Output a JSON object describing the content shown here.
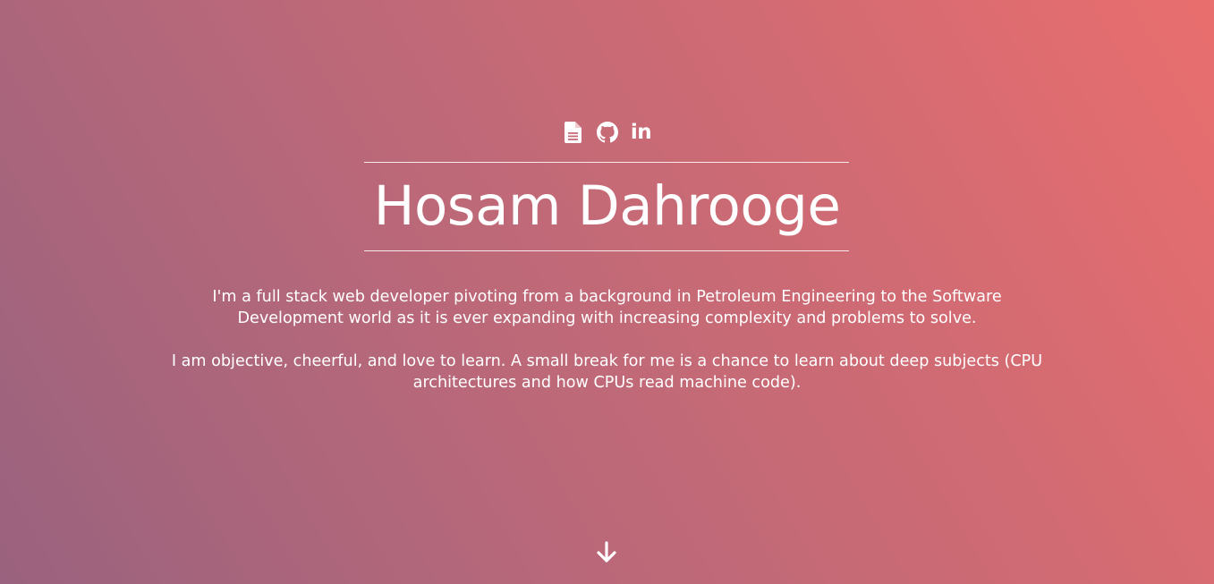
{
  "social": {
    "items": [
      {
        "icon": "file-document-icon",
        "label": "Resume"
      },
      {
        "icon": "github-icon",
        "label": "GitHub"
      },
      {
        "icon": "linkedin-icon",
        "label": "in"
      }
    ]
  },
  "hero": {
    "name": "Hosam Dahrooge",
    "paragraphs": [
      "I'm a full stack web developer pivoting from a background in Petroleum Engineering to the Software Development world as it is ever expanding with increasing complexity and problems to solve.",
      "I am objective, cheerful, and love to learn. A small break for me is a chance to learn about deep subjects (CPU architectures and how CPUs read machine code)."
    ]
  },
  "scroll": {
    "icon": "arrow-down-icon"
  },
  "colors": {
    "gradient_start": "#9a627e",
    "gradient_end": "#e96e6e",
    "text": "#ffffff"
  }
}
